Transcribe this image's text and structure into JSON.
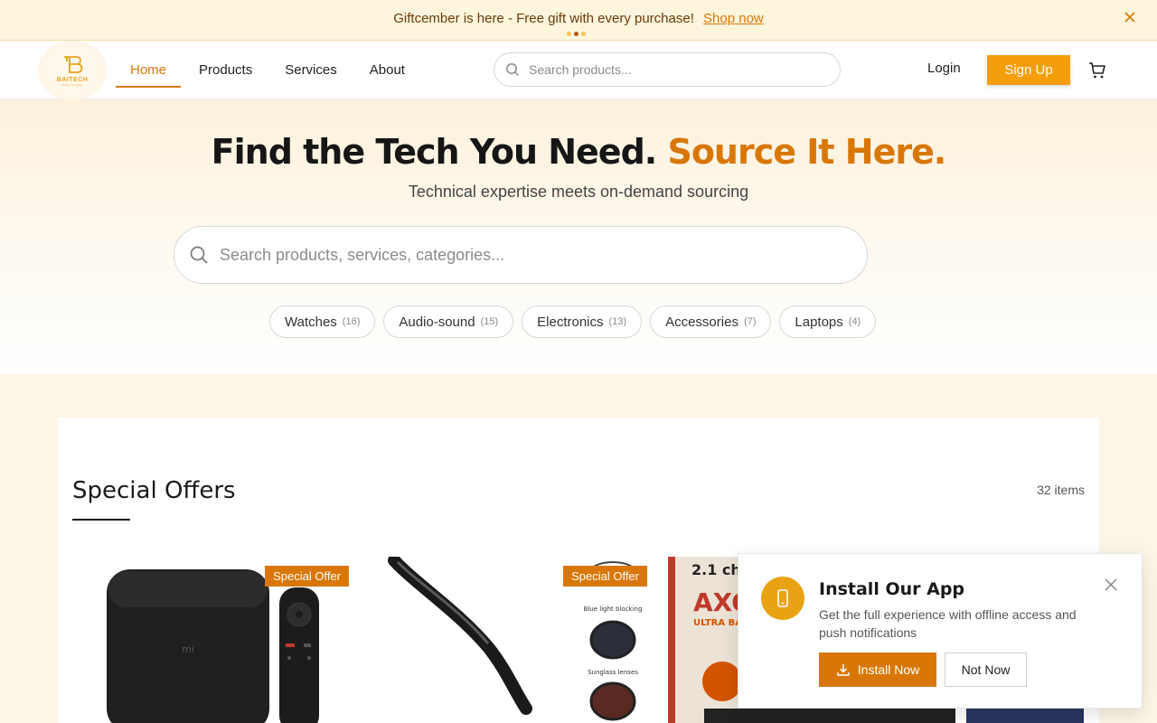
{
  "announcement": {
    "text": "Giftcember is here - Free gift with every purchase!",
    "link": "Shop now"
  },
  "logo": {
    "name": "BAITECH",
    "tagline": "SOLUTIONS"
  },
  "nav": {
    "items": [
      {
        "label": "Home",
        "active": true
      },
      {
        "label": "Products"
      },
      {
        "label": "Services"
      },
      {
        "label": "About"
      }
    ]
  },
  "header_search": {
    "placeholder": "Search products..."
  },
  "auth": {
    "login": "Login",
    "signup": "Sign Up"
  },
  "hero": {
    "title_main": "Find the Tech You Need.",
    "title_accent": "Source It Here.",
    "subtitle": "Technical expertise meets on-demand sourcing",
    "search_placeholder": "Search products, services, categories...",
    "categories": [
      {
        "name": "Watches",
        "count": "(16)"
      },
      {
        "name": "Audio-sound",
        "count": "(15)"
      },
      {
        "name": "Electronics",
        "count": "(13)"
      },
      {
        "name": "Accessories",
        "count": "(7)"
      },
      {
        "name": "Laptops",
        "count": "(4)"
      }
    ]
  },
  "offers": {
    "title": "Special Offers",
    "count": "32 items",
    "badge": "Special Offer",
    "card3_brand": "AXO",
    "card3_headline": "2.1 cha",
    "card3_sub": "ULTRA BASS",
    "glasses_labels": [
      "Blue light blocking",
      "Sunglass lenses"
    ]
  },
  "install_app": {
    "title": "Install Our App",
    "description": "Get the full experience with offline access and push notifications",
    "install": "Install Now",
    "not_now": "Not Now"
  },
  "colors": {
    "accent": "#d97706",
    "signup": "#f59e0b",
    "announcement_bg": "#fdf5dc"
  }
}
